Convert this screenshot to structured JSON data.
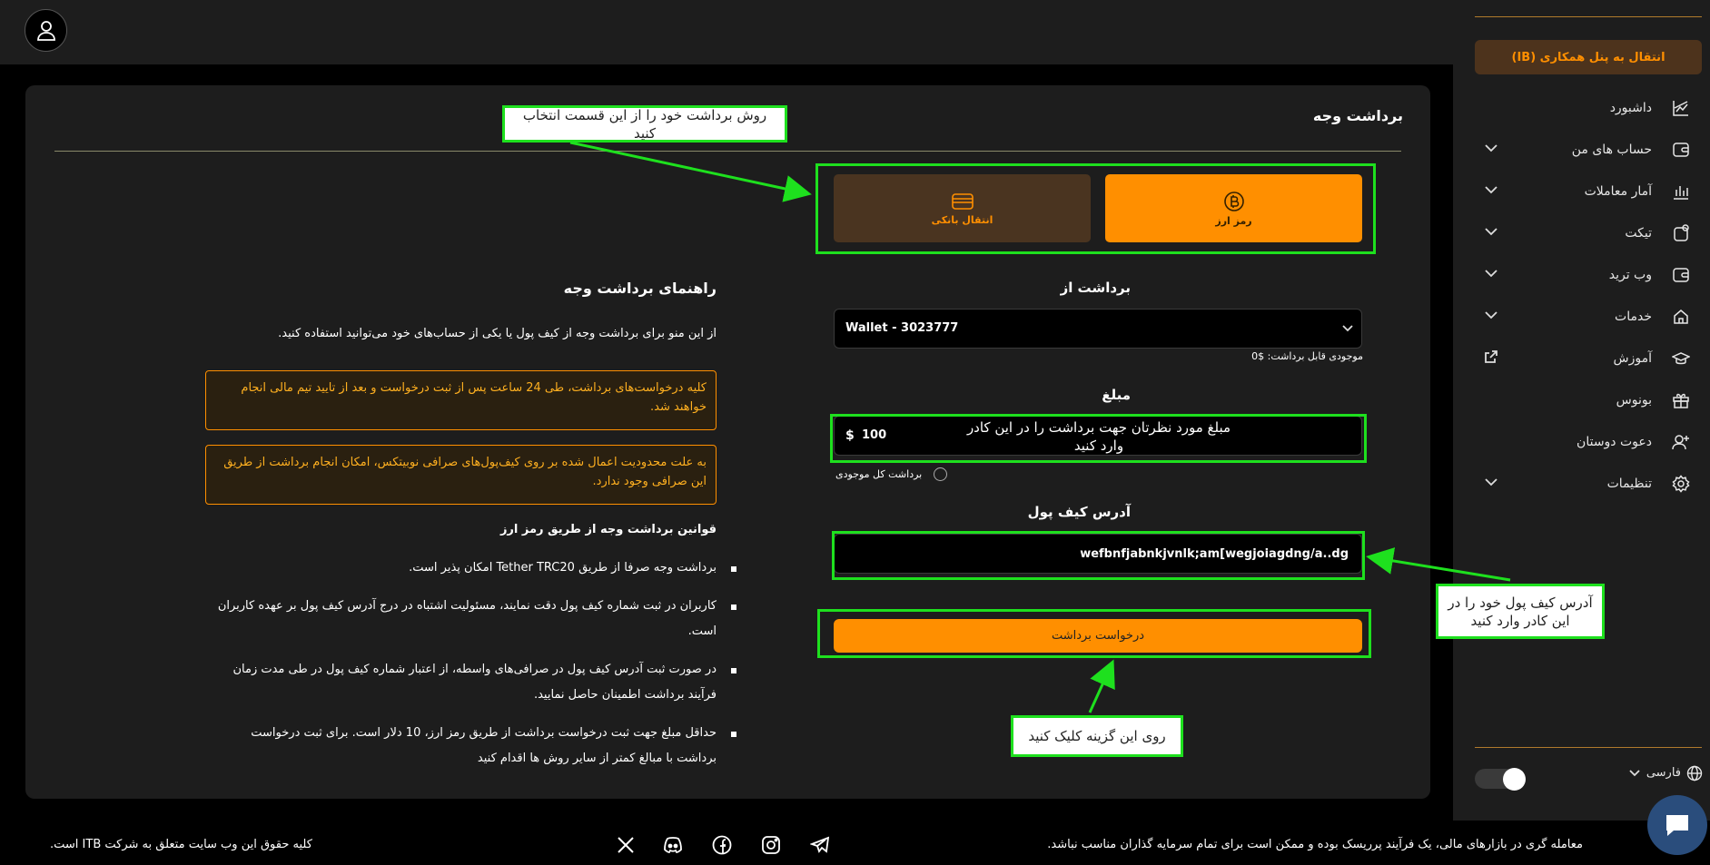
{
  "sidebar": {
    "ib_button": "انتقال به پنل همکاری (IB)",
    "items": [
      {
        "label": "داشبورد",
        "icon": "chart-icon",
        "expandable": false
      },
      {
        "label": "حساب های من",
        "icon": "wallet-icon",
        "expandable": true
      },
      {
        "label": "آمار معاملات",
        "icon": "bar-chart-icon",
        "expandable": true
      },
      {
        "label": "تیکت",
        "icon": "ticket-icon",
        "expandable": true
      },
      {
        "label": "وب ترید",
        "icon": "web-trade-icon",
        "expandable": true
      },
      {
        "label": "خدمات",
        "icon": "services-icon",
        "expandable": true
      },
      {
        "label": "آموزش",
        "icon": "education-icon",
        "expandable": false,
        "external": true
      },
      {
        "label": "بونوس",
        "icon": "gift-icon",
        "expandable": false
      },
      {
        "label": "دعوت دوستان",
        "icon": "invite-user-icon",
        "expandable": false
      },
      {
        "label": "تنظیمات",
        "icon": "gear-icon",
        "expandable": true
      }
    ],
    "language": "فارسی",
    "theme_toggle_on": true
  },
  "main": {
    "title": "برداشت وجه",
    "methods": [
      {
        "label": "رمز ارز",
        "icon": "bitcoin-icon",
        "selected": true
      },
      {
        "label": "انتقال بانکی",
        "icon": "credit-card-icon",
        "selected": false
      }
    ],
    "form": {
      "from_label": "برداشت از",
      "wallet_value": "Wallet - 3023777",
      "balance_text": "موجودی قابل برداشت: $0",
      "amount_label": "مبلغ",
      "amount_currency": "$",
      "amount_value": "100",
      "withdraw_all_label": "برداشت کل موجودی",
      "address_label": "آدرس کیف پول",
      "address_value": "wefbnfjabnkjvnlk;am[wegjoiagdng/a..dg",
      "submit_label": "درخواست برداشت"
    },
    "guide": {
      "title": "راهنمای برداشت وجه",
      "intro": "از این منو برای برداشت وجه از کیف پول یا یکی از حساب‌های خود می‌توانید استفاده کنید.",
      "notice1": "کلیه درخواست‌های برداشت، طی 24 ساعت پس از ثبت درخواست و بعد از تایید تیم مالی انجام خواهند شد.",
      "notice2": "به علت محدودیت اعمال شده بر روی کیف‌پول‌های صرافی نوبیتکس، امکان انجام برداشت از طریق این صرافی وجود ندارد.",
      "rules_title": "قوانین برداشت وجه از طریق رمز ارز",
      "rules": [
        "برداشت وجه صرفا از طریق Tether TRC20 امکان پذیر است.",
        "کاربران در ثبت شماره کیف پول دقت نمایند، مسئولیت اشتباه در درج آدرس کیف پول بر عهده کاربران است.",
        "در صورت ثبت آدرس کیف پول در صرافی‌های واسطه، از اعتبار شماره کیف پول در طی مدت زمان فرآیند برداشت اطمینان حاصل نمایید.",
        "حداقل مبلغ جهت ثبت درخواست برداشت از طریق رمز ارز، 10 دلار است. برای ثبت درخواست برداشت با مبالغ کمتر از سایر روش ها اقدام کنید"
      ]
    }
  },
  "annotations": {
    "method_hint": "روش برداشت خود را از این قسمت انتخاب کنید",
    "amount_hint": "مبلغ مورد نظرتان جهت برداشت را در این کادر وارد کنید",
    "address_hint": "آدرس کیف پول خود را در این کادر وارد کنید",
    "submit_hint": "روی این گزینه کلیک کنید"
  },
  "footer": {
    "copyright": "کلیه حقوق این وب سایت متعلق به شرکت ITB است.",
    "disclaimer": "معامله گری در بازارهای مالی، یک فرآیند پرریسک بوده و ممکن است برای تمام سرمایه گذاران مناسب نباشد.",
    "socials": [
      "x-icon",
      "discord-icon",
      "facebook-icon",
      "instagram-icon",
      "telegram-icon"
    ]
  },
  "colors": {
    "accent": "#ff8f00",
    "highlight": "#1ee01e",
    "panel": "#1d1d1d",
    "background": "#000000"
  }
}
